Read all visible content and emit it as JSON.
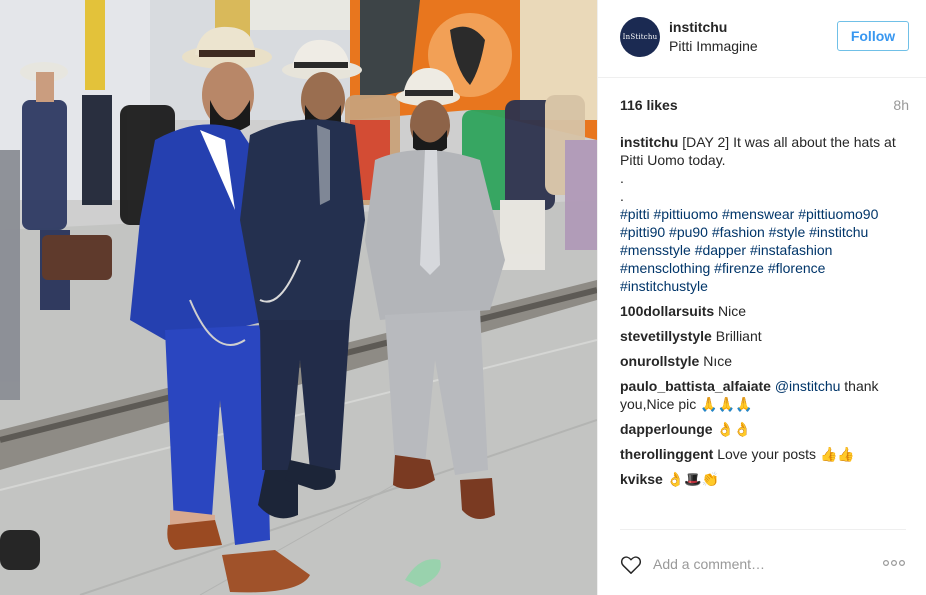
{
  "header": {
    "avatar_text": "InStitchu",
    "username": "institchu",
    "location": "Pitti Immagine",
    "follow_label": "Follow"
  },
  "stats": {
    "likes": "116 likes",
    "time": "8h"
  },
  "caption": {
    "user": "institchu",
    "text": "[DAY 2] It was all about the hats at Pitti Uomo today.",
    "dot1": ".",
    "dot2": ".",
    "hashtags": "#pitti #pittiuomo #menswear #pittiuomo90 #pitti90 #pu90 #fashion #style #institchu #mensstyle #dapper #instafashion #mensclothing #firenze #florence #institchustyle"
  },
  "comments": [
    {
      "user": "100dollarsuits",
      "text": "Nice"
    },
    {
      "user": "stevetillystyle",
      "text": "Brilliant"
    },
    {
      "user": "onurollstyle",
      "text": "Nıce"
    },
    {
      "user": "paulo_battista_alfaiate",
      "mention": "@institchu",
      "text": "thank you,Nice pic 🙏🙏🙏"
    },
    {
      "user": "dapperlounge",
      "text": "👌👌"
    },
    {
      "user": "therollinggent",
      "text": "Love your posts 👍👍"
    },
    {
      "user": "kvikse",
      "text": "👌🎩👏"
    }
  ],
  "footer": {
    "add_comment_placeholder": "Add a comment…"
  },
  "icons": {
    "like": "heart-icon",
    "options": "more-options-icon"
  },
  "colors": {
    "link": "#003569",
    "follow": "#3897f0",
    "muted": "#999999",
    "suit_blue": "#2540b0",
    "suit_navy": "#24304f",
    "suit_grey": "#b3b5b9"
  }
}
